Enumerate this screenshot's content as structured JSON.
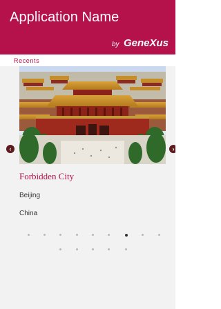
{
  "header": {
    "title": "Application Name",
    "by": "by",
    "brand": "GeneXus"
  },
  "section": {
    "label": "Recents"
  },
  "item": {
    "name": "Forbidden City",
    "city": "Beijing",
    "country": "China"
  },
  "pager": {
    "total": 14,
    "active_index": 6
  },
  "colors": {
    "brand": "#b5114a",
    "arrow": "#5b1a1e"
  },
  "icons": {
    "prev": "chevron-left-icon",
    "next": "chevron-right-icon"
  }
}
